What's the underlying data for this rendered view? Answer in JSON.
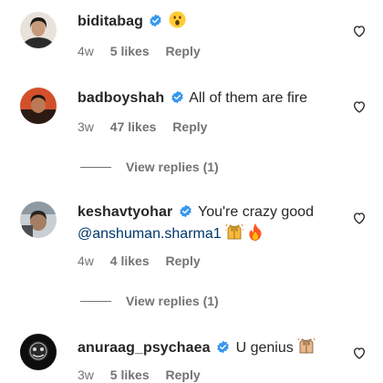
{
  "comments": [
    {
      "username": "biditabag",
      "text": "",
      "emoji": "astonished-face",
      "time": "4w",
      "likes": "5 likes",
      "reply": "Reply"
    },
    {
      "username": "badboyshah",
      "text": "All of them are fire",
      "time": "3w",
      "likes": "47 likes",
      "reply": "Reply",
      "view_replies": "View replies (1)"
    },
    {
      "username": "keshavtyohar",
      "text": "You're crazy good",
      "mention": "@anshuman.sharma1",
      "emojis": [
        "raising-hands",
        "fire"
      ],
      "time": "4w",
      "likes": "4 likes",
      "reply": "Reply",
      "view_replies": "View replies (1)"
    },
    {
      "username": "anuraag_psychaea",
      "text": "U genius",
      "emojis": [
        "raising-hands"
      ],
      "time": "3w",
      "likes": "5 likes",
      "reply": "Reply"
    }
  ],
  "colors": {
    "verified": "#3797f0",
    "muted": "#737373",
    "mention": "#00376b"
  }
}
